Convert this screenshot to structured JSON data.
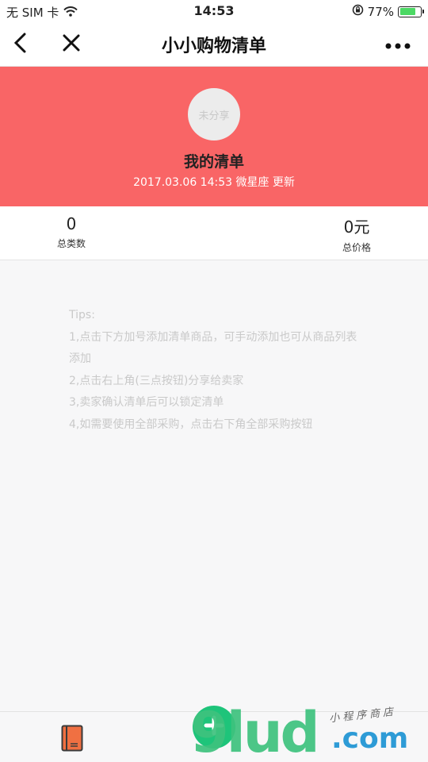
{
  "status": {
    "carrier": "无 SIM 卡",
    "time": "14:53",
    "battery": "77%",
    "battery_level": 0.77
  },
  "nav": {
    "title": "小小购物清单"
  },
  "header": {
    "avatar_text": "未分享",
    "title": "我的清单",
    "meta": "2017.03.06 14:53 微星座 更新"
  },
  "stats": {
    "count_value": "0",
    "count_label": "总类数",
    "price_value": "0元",
    "price_label": "总价格"
  },
  "tips": [
    "Tips:",
    "1,点击下方加号添加清单商品，可手动添加也可从商品列表添加",
    "2,点击右上角(三点按钮)分享给卖家",
    "3,卖家确认清单后可以锁定清单",
    "4,如需要使用全部采购，点击右下角全部采购按钮"
  ],
  "watermark": {
    "brand": "9lud",
    "domain": ".com",
    "script": "小程序商店"
  },
  "icons": {
    "back": "chevron-left-icon",
    "close": "close-icon",
    "more": "more-dots-icon",
    "book": "book-icon",
    "add": "plus-icon",
    "wifi": "wifi-icon",
    "orientation_lock": "orientation-lock-icon"
  },
  "colors": {
    "header_bg": "#f96566",
    "add_button": "#1ec47a",
    "battery_fill": "#4cd964"
  }
}
